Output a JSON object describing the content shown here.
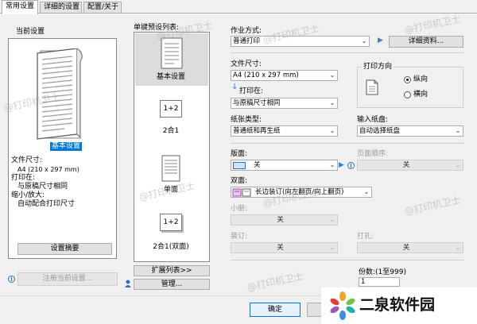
{
  "tabs": [
    "常用设置",
    "详细的设置",
    "配置/关于"
  ],
  "current_settings": {
    "title": "当前设置",
    "preview_label": "基本设置",
    "summary": [
      "文件尺寸:",
      "A4 (210 x 297 mm)",
      "打印在:",
      "与原稿尺寸相同",
      "缩小/放大:",
      "自动配合打印尺寸"
    ],
    "summary_button": "设置摘要",
    "register_button": "注册当前设置..."
  },
  "one_click": {
    "title": "单键预设列表:",
    "items": [
      {
        "label": "基本设置",
        "icon_text": ""
      },
      {
        "label": "2合1",
        "icon_text": "1+2"
      },
      {
        "label": "单面",
        "icon_text": ""
      },
      {
        "label": "2合1(双面)",
        "icon_text": "1+2"
      }
    ],
    "expand_button": "扩展列表>>",
    "manage_button": "管理..."
  },
  "job": {
    "label": "作业方式:",
    "value": "普通打印",
    "detail_button": "详细资料..."
  },
  "paper_size": {
    "label": "文件尺寸:",
    "value": "A4 (210 x 297 mm)"
  },
  "print_on": {
    "label": "打印在:",
    "value": "与原稿尺寸相同"
  },
  "orientation": {
    "title": "打印方向",
    "options": [
      "纵向",
      "横向"
    ],
    "selected": "纵向"
  },
  "media_type": {
    "label": "纸张类型:",
    "value": "普通纸和再生纸"
  },
  "input_tray": {
    "label": "输入纸盘:",
    "value": "自动选择纸盘"
  },
  "layout": {
    "label": "版面:",
    "value": "关"
  },
  "page_order": {
    "label": "页面顺序:",
    "value": "关"
  },
  "duplex": {
    "label": "双面:",
    "value": "长边装订(向左翻页/向上翻页)"
  },
  "booklet": {
    "label": "小册:",
    "value": "关"
  },
  "binding": {
    "label": "装订:",
    "value": "关"
  },
  "punch": {
    "label": "打孔:",
    "value": "关"
  },
  "copies": {
    "label": "份数:(1至999)",
    "value": "1"
  },
  "dialog": {
    "ok_button": "确定"
  },
  "watermarks": [
    "@打印机卫士",
    "@打印机卫士",
    "@打印机卫士",
    "@打印机卫士",
    "@打印机卫士",
    "@打印机卫士",
    "@打印机卫士",
    "@打印机卫士"
  ],
  "brand": {
    "name": "二泉软件园"
  }
}
